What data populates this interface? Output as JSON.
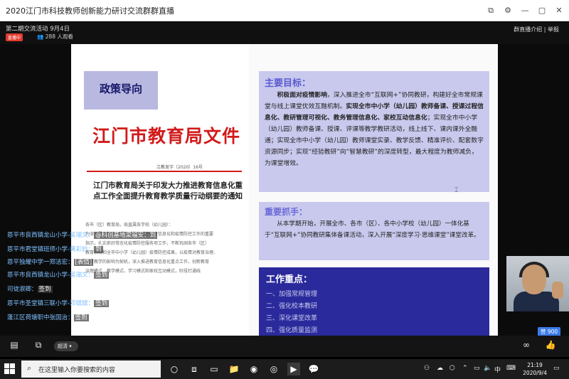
{
  "window": {
    "title": "2020江门市科技教师创新能力研讨交流群群直播",
    "icons": [
      "picture-in-picture-icon",
      "settings-icon",
      "minimize-icon",
      "maximize-icon",
      "close-icon"
    ]
  },
  "live": {
    "session": "第二期交流活动 9月4日",
    "badge": "直播中",
    "viewers": "288 人观看",
    "links": "群直播介绍 | 举报"
  },
  "slide": {
    "policy_tag": "政策导向",
    "doc_title": "江门市教育局文件",
    "doc_number": "江教发字〔2020〕16号",
    "notice_title": "江门市教育局关于印发大力推进教育信息化重点工作全面提升教育教学质量行动纲要的通知",
    "fine_lines": [
      "各市（区）教育局，局直属各学校（幼儿园）：",
      "为深入贯彻落实习近平总书记关于教育信息化和疫情防控工作的重要",
      "指示，扎实抓好常态化疫情防控服务项工作，不断巩固各市（区）",
      "教育系统和全市中小学（幼儿园）疫情防控成果，以疫情对教育治理、",
      "教育教学的影响为契机，深入推进教育信息化重点工作，创新教育",
      "治理模式、教学模式、学习模式和家校互动模式，阶段打通线"
    ],
    "goal_title": "主要目标：",
    "goal_parts": [
      {
        "text": "积极面对疫情影响",
        "bold": true
      },
      {
        "text": "，深入推进全市“互联网+”协同教研，构建好全市常规课堂与线上课堂优效互融机制。",
        "bold": false
      },
      {
        "text": "实现全市中小学（幼儿园）教师备课、授课过程信息化、教研管理可视化、教务管理信息化、家校互动信息化",
        "bold": true
      },
      {
        "text": "；实现全市中小学（幼儿园）教师备课、授课、评课等教学教研活动，线上线下、课内课外全融通；实现全市中小学（幼儿园）教师课堂实录、教学反馈、精准评价、配套数字资源同步；实现“经验教研”向“智慧教研”的深度转型，最大程度为教师减负，为课堂增效。",
        "bold": false
      }
    ],
    "focus_title": "重要抓手：",
    "focus_text": "从本学期开始，开展全市、各市（区）、各中小学校（幼儿园）一体化基于“互联网+”协同教研集体备课活动，深入开展“深度学习·思维课堂”课堂改革。",
    "work_title": "工作重点：",
    "work_items": [
      "一、加强常规管理",
      "二、强化校本教研",
      "三、深化课堂改革",
      "四、强化质量监测"
    ]
  },
  "comments": [
    {
      "name": "恩平市良西镇龙山小学",
      "sep": "-吴瑞文：",
      "msg": "@科创基地梁福安：到"
    },
    {
      "name": "恩平市君堂镇班师小学",
      "sep": "-黄彩妙：",
      "msg": "到"
    },
    {
      "name": "恩平独耀中学一郑洁宏：",
      "sep": "",
      "msg": "[表情]"
    },
    {
      "name": "恩平市良西镇龙山小学",
      "sep": "-吴瑞文：",
      "msg": "签到"
    },
    {
      "name": "司徒淑卿：",
      "sep": "",
      "msg": "签到"
    },
    {
      "name": "恩平市圣堂镇三联小学",
      "sep": "-邓嫦嫦：",
      "msg": "签到"
    },
    {
      "name": "蓬江区荷塘职中张国治：",
      "sep": "",
      "msg": "签到"
    }
  ],
  "likes": "赞 900",
  "bottom": {
    "quality_label": "超清"
  },
  "taskbar": {
    "search_placeholder": "在这里输入你要搜索的内容",
    "ime": "中",
    "time": "21:19",
    "date": "2020/9/4"
  },
  "colors": {
    "accent_blue": "#2a2a9c",
    "box_lilac": "#c9c9ee",
    "doc_red": "#d21a1a",
    "comment_name": "#7ec0ff",
    "live_badge": "#e23a2e"
  }
}
